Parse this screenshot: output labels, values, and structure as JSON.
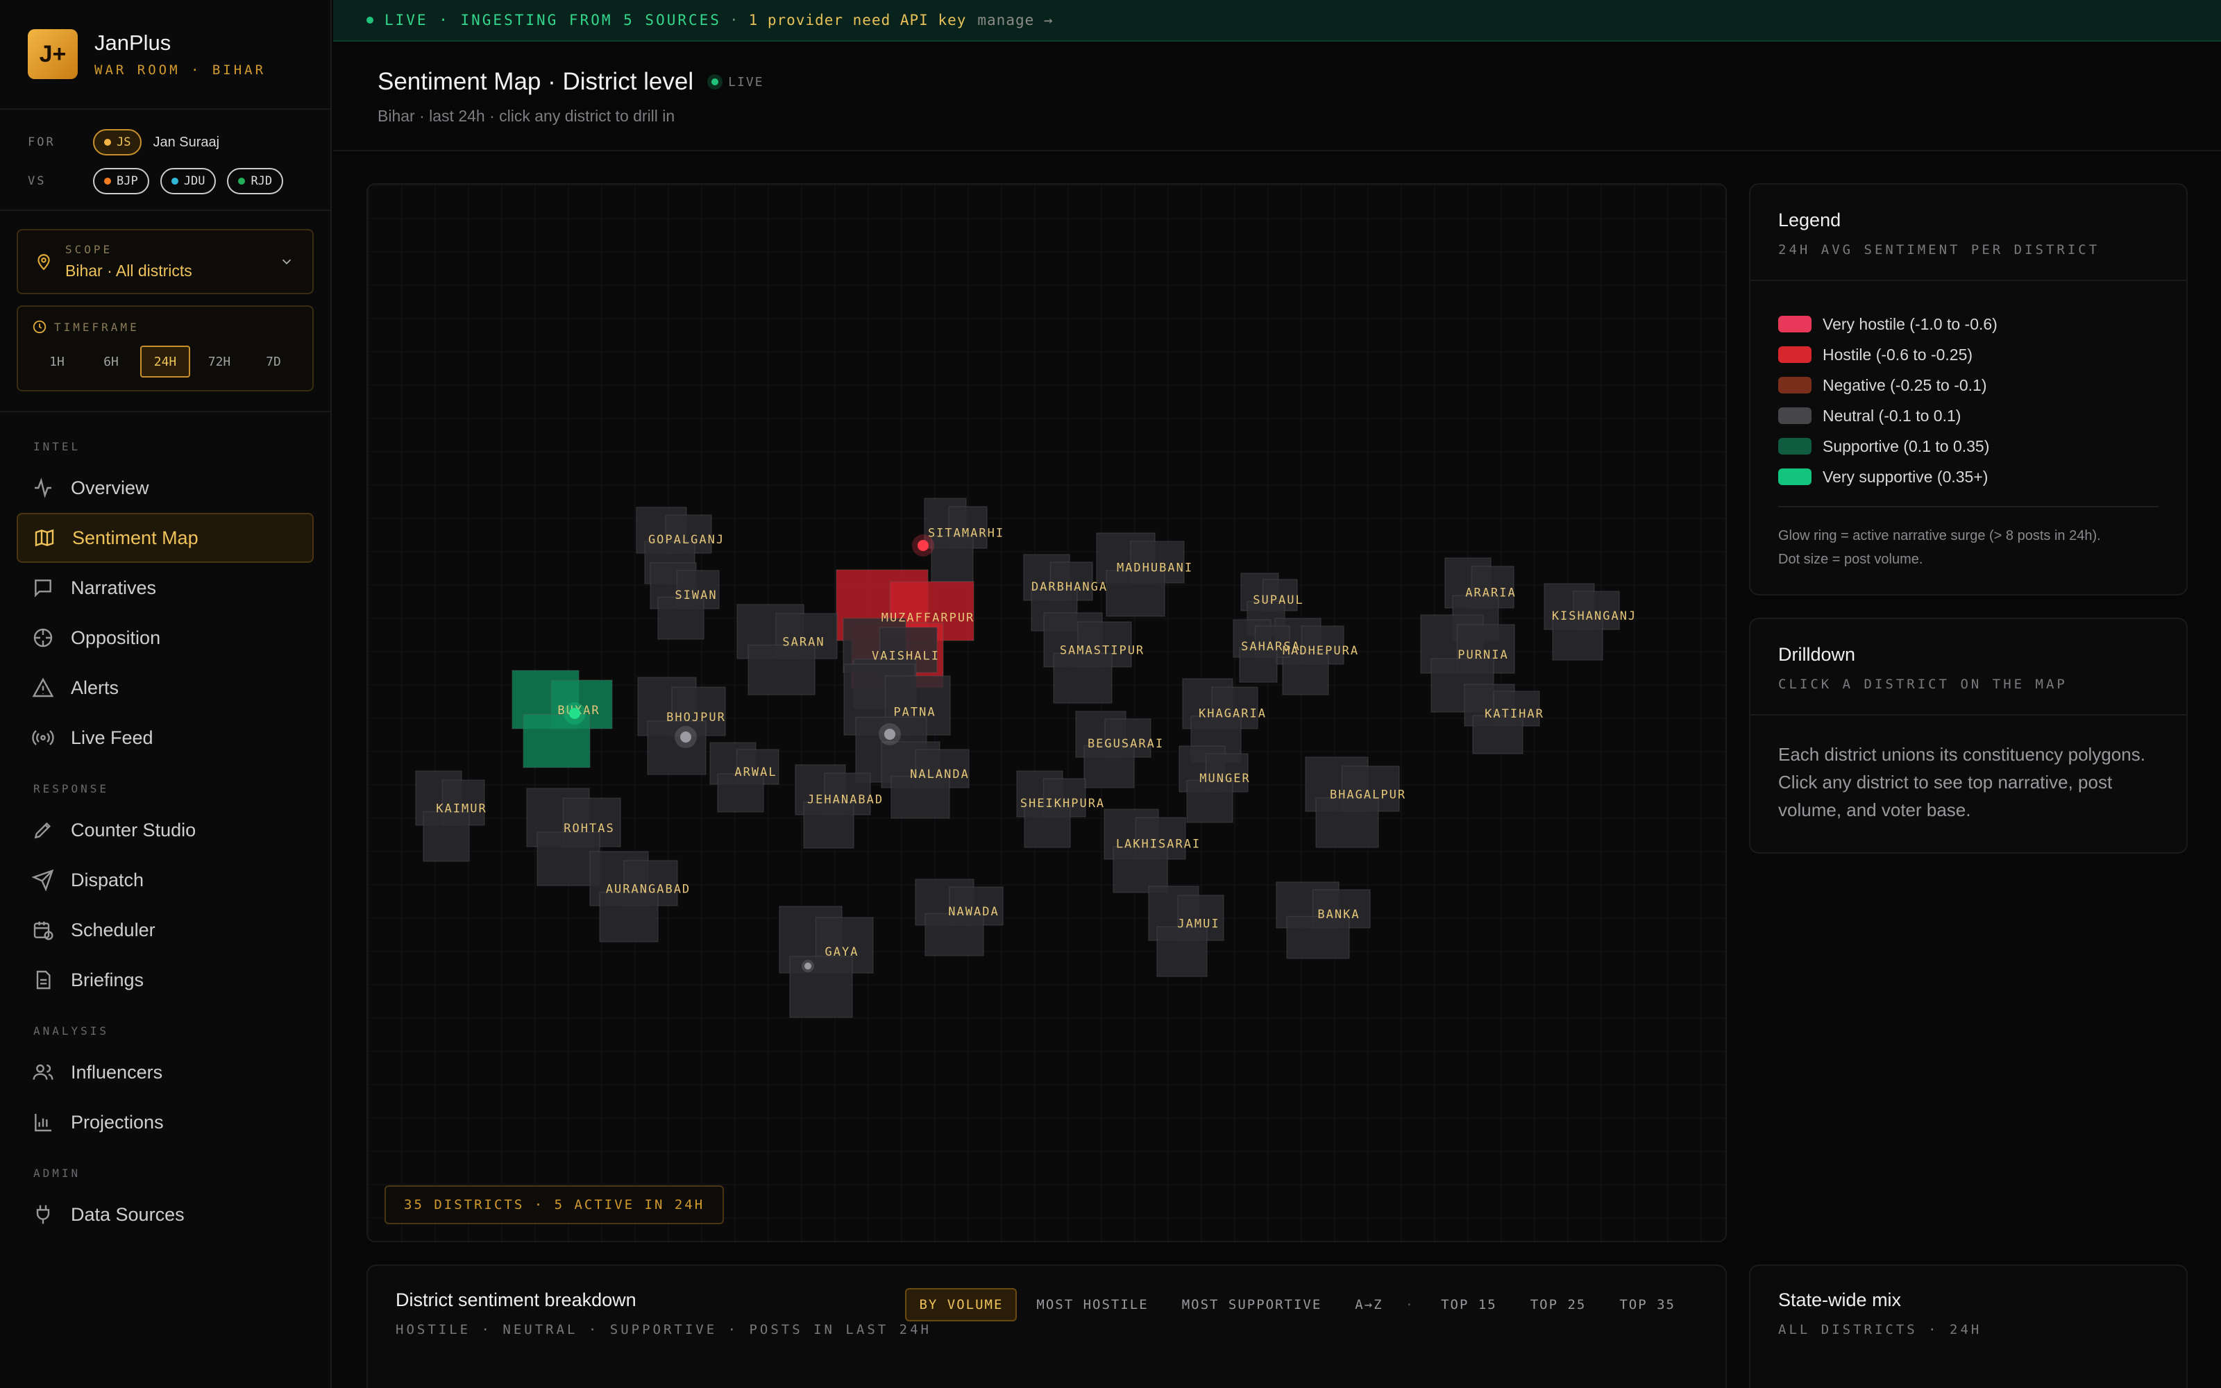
{
  "brand": {
    "logo": "J+",
    "name": "JanPlus",
    "sub": "WAR ROOM · BIHAR"
  },
  "parties": {
    "for_label": "FOR",
    "vs_label": "VS",
    "own": {
      "code": "JS",
      "name": "Jan Suraaj",
      "color": "#f2b544"
    },
    "rivals": [
      {
        "code": "BJP",
        "color": "#f57c21"
      },
      {
        "code": "JDU",
        "color": "#2fb8d8"
      },
      {
        "code": "RJD",
        "color": "#22b05a"
      }
    ]
  },
  "scope": {
    "label": "SCOPE",
    "value": "Bihar · All districts"
  },
  "timeframe": {
    "label": "TIMEFRAME",
    "options": [
      "1H",
      "6H",
      "24H",
      "72H",
      "7D"
    ],
    "selected": "24H"
  },
  "nav": {
    "intel_label": "INTEL",
    "overview": "Overview",
    "sentiment_map": "Sentiment Map",
    "narratives": "Narratives",
    "opposition": "Opposition",
    "alerts": "Alerts",
    "live_feed": "Live Feed",
    "response_label": "RESPONSE",
    "counter_studio": "Counter Studio",
    "dispatch": "Dispatch",
    "scheduler": "Scheduler",
    "briefings": "Briefings",
    "analysis_label": "ANALYSIS",
    "influencers": "Influencers",
    "projections": "Projections",
    "admin_label": "ADMIN",
    "data_sources": "Data Sources"
  },
  "banner": {
    "live": "LIVE · INGESTING FROM 5 SOURCES",
    "sep": "·",
    "warning": "1 provider need API key",
    "manage": "manage →"
  },
  "header": {
    "title": "Sentiment Map · District level",
    "live": "LIVE",
    "subtitle": "Bihar · last 24h · click any district to drill in"
  },
  "map": {
    "badge": "35 DISTRICTS · 5 ACTIVE IN 24H",
    "colors": {
      "neutral": "#2c2c30",
      "hostile": "#c8202a",
      "very_supportive": "#0f8a5c",
      "label": "#e6c77a"
    },
    "districts": [
      {
        "name": "GOPALGANJ"
      },
      {
        "name": "SITAMARHI"
      },
      {
        "name": "MADHUBANI"
      },
      {
        "name": "DARBHANGA"
      },
      {
        "name": "MUZAFFARPUR",
        "sentiment": "hostile",
        "active": true
      },
      {
        "name": "SIWAN"
      },
      {
        "name": "SUPAUL"
      },
      {
        "name": "ARARIA"
      },
      {
        "name": "KISHANGANJ"
      },
      {
        "name": "SARAN"
      },
      {
        "name": "SAMASTIPUR"
      },
      {
        "name": "MADHEPURA"
      },
      {
        "name": "SAHARSA"
      },
      {
        "name": "PURNIA"
      },
      {
        "name": "VAISHALI"
      },
      {
        "name": "BUXAR",
        "sentiment": "very_supportive",
        "active": true
      },
      {
        "name": "BHOJPUR",
        "active": true
      },
      {
        "name": "PATNA",
        "active": true
      },
      {
        "name": "KHAGARIA"
      },
      {
        "name": "KATIHAR"
      },
      {
        "name": "BEGUSARAI"
      },
      {
        "name": "MUNGER"
      },
      {
        "name": "ARWAL"
      },
      {
        "name": "NALANDA"
      },
      {
        "name": "JEHANABAD"
      },
      {
        "name": "SHEIKHPURA"
      },
      {
        "name": "BHAGALPUR"
      },
      {
        "name": "KAIMUR"
      },
      {
        "name": "LAKHISARAI"
      },
      {
        "name": "ROHTAS"
      },
      {
        "name": "AURANGABAD"
      },
      {
        "name": "BANKA"
      },
      {
        "name": "NAWADA"
      },
      {
        "name": "JAMUI"
      },
      {
        "name": "GAYA",
        "active": true
      }
    ]
  },
  "legend": {
    "title": "Legend",
    "sub": "24H AVG SENTIMENT PER DISTRICT",
    "items": [
      {
        "label": "Very hostile (-1.0 to -0.6)",
        "color": "#e8385a"
      },
      {
        "label": "Hostile (-0.6 to -0.25)",
        "color": "#d7262c"
      },
      {
        "label": "Negative (-0.25 to -0.1)",
        "color": "#7a2e1c"
      },
      {
        "label": "Neutral (-0.1 to 0.1)",
        "color": "#45454a"
      },
      {
        "label": "Supportive (0.1 to 0.35)",
        "color": "#0f5c40"
      },
      {
        "label": "Very supportive (0.35+)",
        "color": "#12c47e"
      }
    ],
    "note1": "Glow ring = active narrative surge (> 8 posts in 24h).",
    "note2": "Dot size = post volume."
  },
  "drilldown": {
    "title": "Drilldown",
    "sub": "CLICK A DISTRICT ON THE MAP",
    "body": "Each district unions its constituency polygons. Click any district to see top narrative, post volume, and voter base."
  },
  "breakdown": {
    "title": "District sentiment breakdown",
    "sub": "HOSTILE · NEUTRAL · SUPPORTIVE · POSTS IN LAST 24H",
    "sorts": [
      "BY VOLUME",
      "MOST HOSTILE",
      "MOST SUPPORTIVE",
      "A→Z"
    ],
    "sort_sep": "·",
    "tops": [
      "TOP 15",
      "TOP 25",
      "TOP 35"
    ]
  },
  "statewide": {
    "title": "State-wide mix",
    "sub": "ALL DISTRICTS · 24H"
  }
}
